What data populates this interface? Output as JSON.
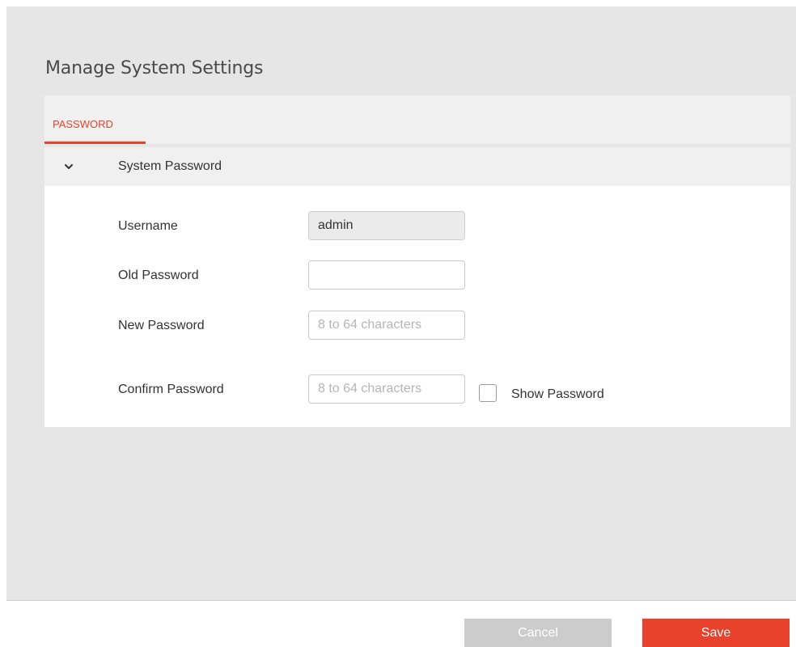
{
  "page": {
    "title": "Manage System Settings"
  },
  "tabs": [
    {
      "label": "PASSWORD",
      "active": true
    }
  ],
  "section": {
    "title": "System Password",
    "expanded": true,
    "icon": "chevron-down-icon"
  },
  "form": {
    "username": {
      "label": "Username",
      "value": "admin"
    },
    "old_password": {
      "label": "Old Password",
      "value": "",
      "placeholder": ""
    },
    "new_password": {
      "label": "New Password",
      "value": "",
      "placeholder": "8 to 64 characters"
    },
    "confirm_password": {
      "label": "Confirm Password",
      "value": "",
      "placeholder": "8 to 64 characters"
    },
    "show_password": {
      "label": "Show Password",
      "checked": false
    }
  },
  "footer": {
    "cancel_label": "Cancel",
    "save_label": "Save"
  },
  "colors": {
    "accent": "#e8412c",
    "cancel_button": "#cccccc",
    "background": "#e6e6e6"
  }
}
